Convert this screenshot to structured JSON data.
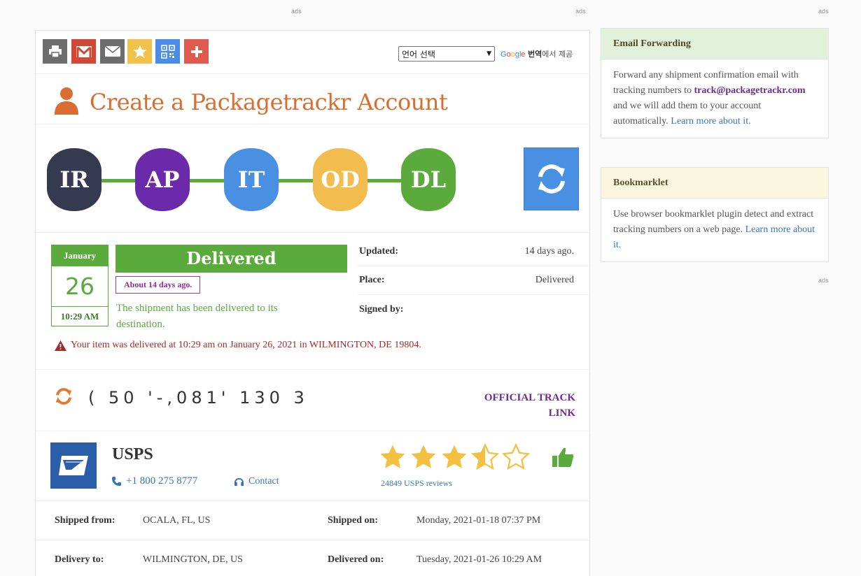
{
  "ads": {
    "label": "ads"
  },
  "toolbar": {
    "buttons": [
      {
        "name": "print-button",
        "icon": "printer-icon",
        "color": "#6d6d6d"
      },
      {
        "name": "gmail-button",
        "icon": "gmail-icon",
        "color": "#d14836"
      },
      {
        "name": "email-button",
        "icon": "envelope-icon",
        "color": "#6d6d6d"
      },
      {
        "name": "favorite-button",
        "icon": "star-icon",
        "color": "#f0c24b"
      },
      {
        "name": "qrcode-button",
        "icon": "qrcode-icon",
        "color": "#4a8de8"
      },
      {
        "name": "add-button",
        "icon": "plus-icon",
        "color": "#e05a4e"
      }
    ],
    "language_select": "언어 선택",
    "powered_suffix": "번역",
    "powered_tail": "에서 제공"
  },
  "header": {
    "title": "Create a Packagetrackr Account"
  },
  "progress": {
    "steps": [
      {
        "code": "IR",
        "color": "#363a50"
      },
      {
        "code": "AP",
        "color": "#6a2aa9"
      },
      {
        "code": "IT",
        "color": "#4a90e2"
      },
      {
        "code": "OD",
        "color": "#f2bd4e"
      },
      {
        "code": "DL",
        "color": "#5aaa3c"
      }
    ],
    "line_color": "#5aaa3c"
  },
  "status": {
    "calendar": {
      "month": "January",
      "day": "26",
      "time": "10:29 AM"
    },
    "banner": "Delivered",
    "relative": "About 14 days ago.",
    "description": "The shipment has been delivered to its destination.",
    "info": [
      {
        "label": "Updated:",
        "value": "14 days ago."
      },
      {
        "label": "Place:",
        "value": "Delivered"
      },
      {
        "label": "Signed by:",
        "value": ""
      }
    ],
    "alert": "Your item was delivered at 10:29 am on January 26, 2021 in WILMINGTON, DE 19804."
  },
  "tracking": {
    "number": "(    50       '-,081'       130 3",
    "official_link": "OFFICIAL TRACK LINK"
  },
  "carrier": {
    "name": "USPS",
    "phone": "+1 800 275 8777",
    "contact": "Contact",
    "rating": 3.5,
    "reviews": "24849 USPS reviews"
  },
  "shipment": {
    "rows": [
      {
        "k1": "Shipped from:",
        "v1": "OCALA, FL, US",
        "k2": "Shipped on:",
        "v2": "Monday, 2021-01-18 07:37 PM"
      },
      {
        "k1": "Delivery to:",
        "v1": "WILMINGTON, DE, US",
        "k2": "Delivered on:",
        "v2": "Tuesday, 2021-01-26 10:29 AM"
      }
    ]
  },
  "sidebar": {
    "email_forwarding": {
      "title": "Email Forwarding",
      "text1": "Forward any shipment confirmation email with tracking numbers to",
      "email": "track@packagetrackr.com",
      "text2": "and we will add them to your account automatically.",
      "link": "Learn more about it."
    },
    "bookmarklet": {
      "title": "Bookmarklet",
      "text": "Use browser bookmarklet plugin detect and extract tracking numbers on a web page.",
      "link": "Learn more about it."
    }
  }
}
